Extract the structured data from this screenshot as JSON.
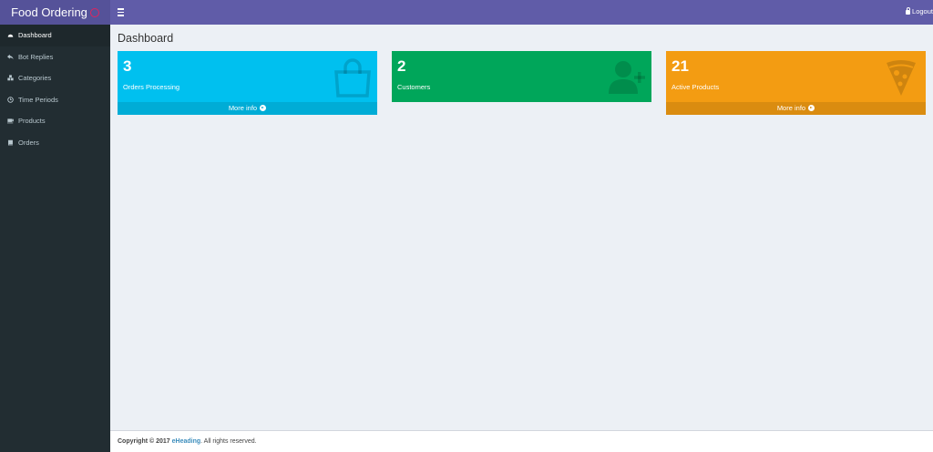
{
  "brand": {
    "name": "Food Ordering"
  },
  "topbar": {
    "logout_label": "Logout",
    "color": "#605ca8"
  },
  "sidebar": {
    "items": [
      {
        "label": "Dashboard",
        "icon": "dashboard-icon",
        "active": true
      },
      {
        "label": "Bot Replies",
        "icon": "reply-icon"
      },
      {
        "label": "Categories",
        "icon": "cubes-icon"
      },
      {
        "label": "Time Periods",
        "icon": "clock-icon"
      },
      {
        "label": "Products",
        "icon": "coffee-icon"
      },
      {
        "label": "Orders",
        "icon": "book-icon"
      }
    ]
  },
  "main": {
    "title": "Dashboard",
    "boxes": [
      {
        "count": "3",
        "label": "Orders Processing",
        "footer": "More info",
        "color": "#00c0ef",
        "icon": "shopping-bag-icon"
      },
      {
        "count": "2",
        "label": "Customers",
        "footer": "",
        "color": "#00a65a",
        "icon": "user-plus-icon"
      },
      {
        "count": "21",
        "label": "Active Products",
        "footer": "More info",
        "color": "#f39c12",
        "icon": "pizza-icon"
      }
    ]
  },
  "footer": {
    "copyright": "Copyright © 2017",
    "company": "eHeading",
    "rights": ". All rights reserved."
  }
}
